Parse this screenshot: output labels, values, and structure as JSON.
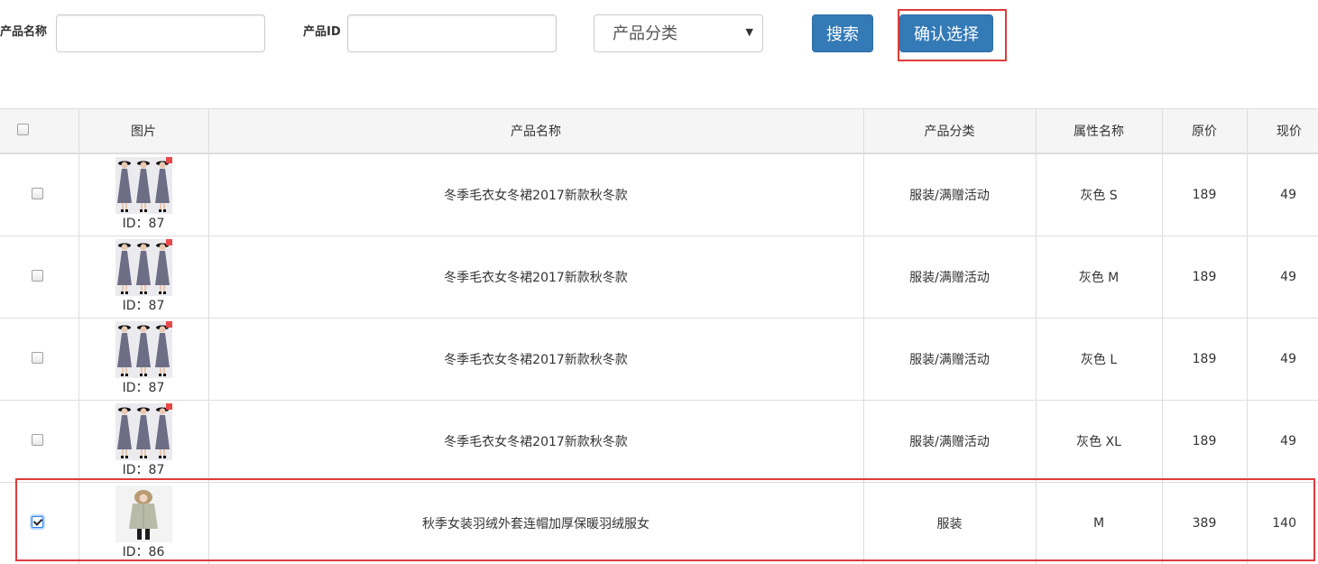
{
  "search": {
    "name_label": "产品名称",
    "name_value": "",
    "id_label": "产品ID",
    "id_value": "",
    "category_value": "产品分类",
    "search_button": "搜索",
    "confirm_button": "确认选择"
  },
  "table": {
    "headers": [
      "图片",
      "产品名称",
      "产品分类",
      "属性名称",
      "原价",
      "现价"
    ],
    "rows": [
      {
        "checked": false,
        "id_text": "ID：87",
        "name": "冬季毛衣女冬裙2017新款秋冬款",
        "category": "服装/满赠活动",
        "attribute": "灰色 S",
        "original_price": "189",
        "current_price": "49",
        "image": "gray-dress"
      },
      {
        "checked": false,
        "id_text": "ID：87",
        "name": "冬季毛衣女冬裙2017新款秋冬款",
        "category": "服装/满赠活动",
        "attribute": "灰色 M",
        "original_price": "189",
        "current_price": "49",
        "image": "gray-dress"
      },
      {
        "checked": false,
        "id_text": "ID：87",
        "name": "冬季毛衣女冬裙2017新款秋冬款",
        "category": "服装/满赠活动",
        "attribute": "灰色 L",
        "original_price": "189",
        "current_price": "49",
        "image": "gray-dress"
      },
      {
        "checked": false,
        "id_text": "ID：87",
        "name": "冬季毛衣女冬裙2017新款秋冬款",
        "category": "服装/满赠活动",
        "attribute": "灰色 XL",
        "original_price": "189",
        "current_price": "49",
        "image": "gray-dress"
      },
      {
        "checked": true,
        "id_text": "ID：86",
        "name": "秋季女装羽绒外套连帽加厚保暖羽绒服女",
        "category": "服装",
        "attribute": "M",
        "original_price": "389",
        "current_price": "140",
        "image": "down-jacket"
      }
    ]
  },
  "colors": {
    "primary_button": "#337ab7",
    "highlight_border": "#e03b3b",
    "header_bg": "#f5f5f5"
  }
}
